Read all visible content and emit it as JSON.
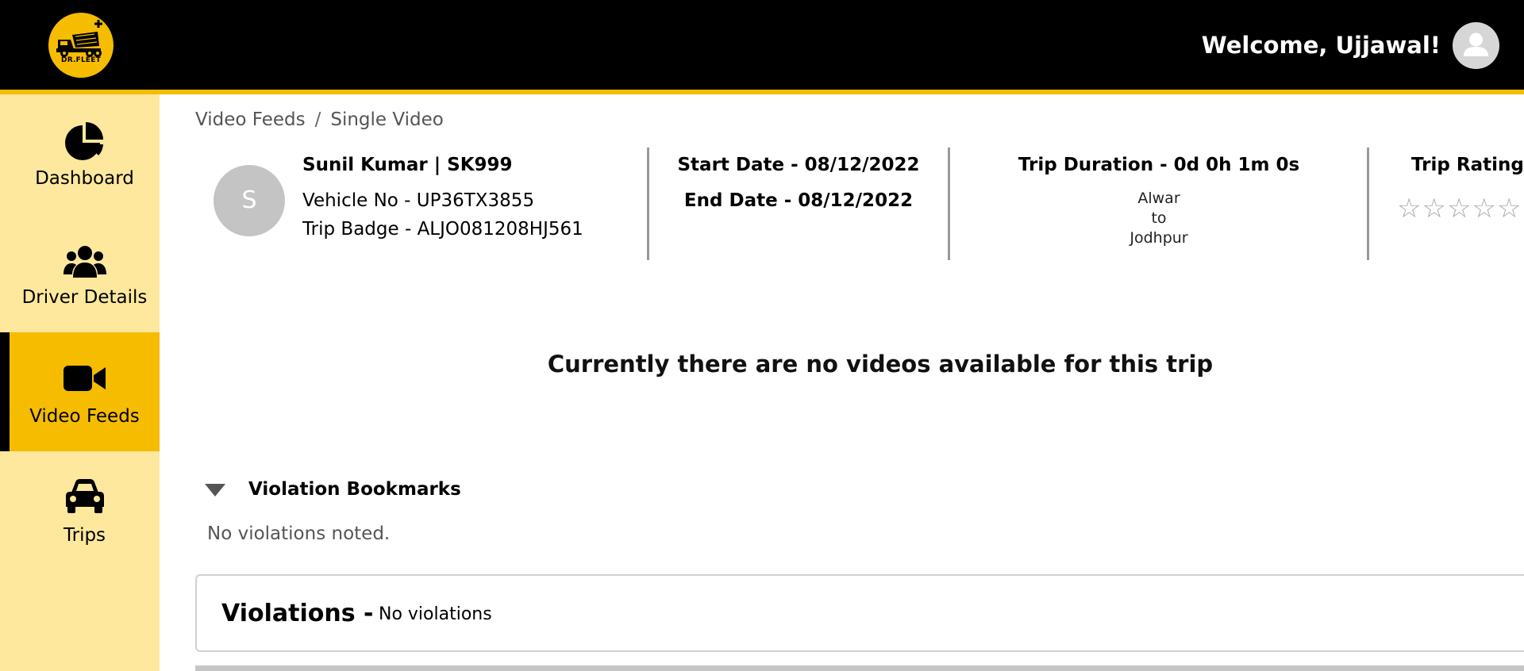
{
  "app": {
    "logo_text": "DR.FLEET",
    "welcome": "Welcome, Ujjawal!",
    "brand_color": "#f6bc00"
  },
  "sidebar": {
    "items": [
      {
        "label": "Dashboard",
        "icon": "pie-chart-icon",
        "active": false
      },
      {
        "label": "Driver Details",
        "icon": "users-icon",
        "active": false
      },
      {
        "label": "Video Feeds",
        "icon": "video-camera-icon",
        "active": true
      },
      {
        "label": "Trips",
        "icon": "car-icon",
        "active": false
      }
    ]
  },
  "breadcrumb": {
    "items": [
      "Video Feeds",
      "Single Video"
    ],
    "separator": "/"
  },
  "trip": {
    "avatar_initial": "S",
    "driver": "Sunil Kumar | SK999",
    "vehicle": "Vehicle No - UP36TX3855",
    "badge": "Trip Badge - ALJO081208HJ561",
    "start_date": "Start Date - 08/12/2022",
    "end_date": "End Date - 08/12/2022",
    "duration": "Trip Duration - 0d 0h 1m 0s",
    "route_from": "Alwar",
    "route_to_word": "to",
    "route_to": "Jodhpur",
    "ratings_title": "Trip Ratings",
    "rating_value": 0,
    "rating_max": 5
  },
  "videos": {
    "empty_message": "Currently there are no videos available for this trip"
  },
  "bookmarks": {
    "title": "Violation Bookmarks",
    "empty": "No violations noted."
  },
  "violations": {
    "label": "Violations -",
    "value": "No violations"
  }
}
